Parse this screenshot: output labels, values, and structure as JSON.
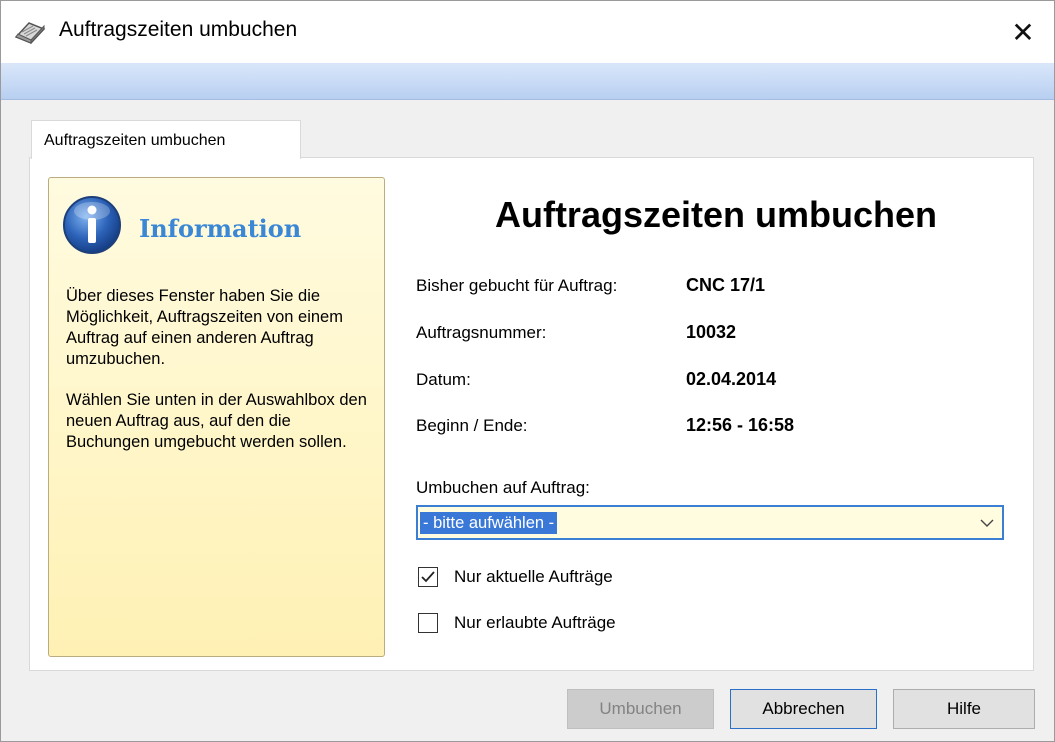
{
  "window": {
    "title": "Auftragszeiten umbuchen",
    "close_glyph": "✕"
  },
  "tabs": [
    {
      "label": "Auftragszeiten umbuchen"
    }
  ],
  "info": {
    "title": "Information",
    "paragraph1": "Über dieses Fenster haben Sie die Möglichkeit, Auftragszeiten von einem Auftrag auf einen anderen Auftrag umzubuchen.",
    "paragraph2": "Wählen Sie unten in der Auswahlbox den neuen Auftrag aus, auf den die Buchungen umgebucht werden sollen."
  },
  "main": {
    "heading": "Auftragszeiten umbuchen",
    "rows": [
      {
        "label": "Bisher gebucht für Auftrag:",
        "value": "CNC 17/1"
      },
      {
        "label": "Auftragsnummer:",
        "value": "10032"
      },
      {
        "label": "Datum:",
        "value": "02.04.2014"
      },
      {
        "label": "Beginn / Ende:",
        "value": "12:56 - 16:58"
      }
    ],
    "combo_label": "Umbuchen auf Auftrag:",
    "combo_value": "- bitte aufwählen -",
    "checkboxes": [
      {
        "label": "Nur aktuelle Aufträge",
        "checked": true
      },
      {
        "label": "Nur erlaubte Aufträge",
        "checked": false
      }
    ]
  },
  "buttons": {
    "umbuchen": "Umbuchen",
    "abbrechen": "Abbrechen",
    "hilfe": "Hilfe"
  },
  "colors": {
    "accent": "#3a78d8",
    "info_title": "#3a87d6",
    "info_bg": "#fff5c8",
    "banner": "#c8daf5"
  },
  "icons": {
    "app": "book-icon",
    "info": "info-icon",
    "close": "close-icon",
    "dropdown": "chevron-down-icon",
    "check": "checkmark-icon"
  }
}
